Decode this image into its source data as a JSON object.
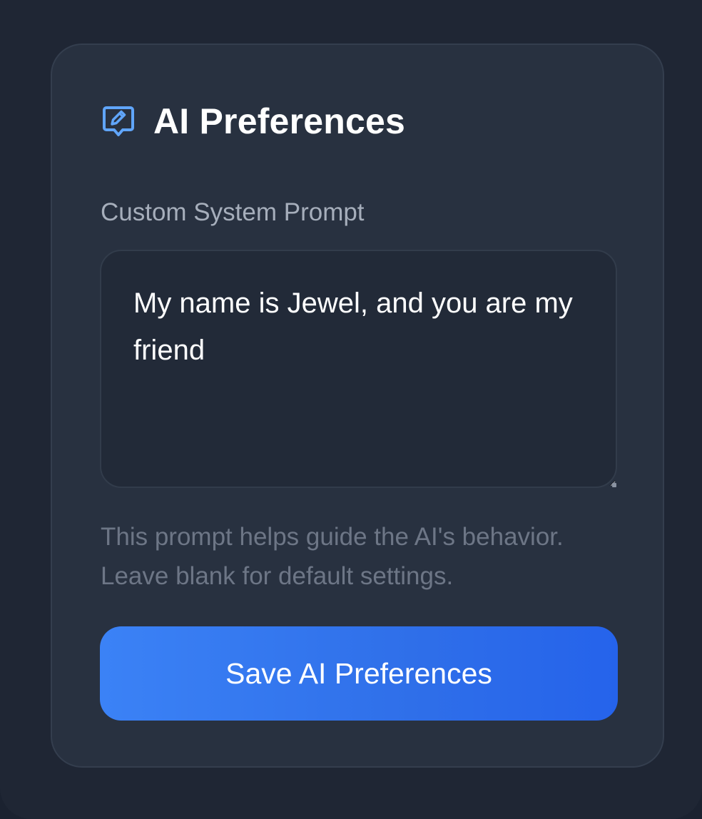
{
  "card": {
    "title": "AI Preferences",
    "title_icon": "chat-edit-icon",
    "field_label": "Custom System Prompt",
    "prompt_value": "My name is Jewel, and you are my friend",
    "help_text": "This prompt helps guide the AI's behavior. Leave blank for default settings.",
    "save_label": "Save AI Preferences"
  },
  "colors": {
    "background": "#1f2634",
    "card": "#283140",
    "textarea": "#222a38",
    "accent": "#3b82f6",
    "icon": "#60a5fa",
    "label": "#a6aebb",
    "help": "#6d7686"
  }
}
